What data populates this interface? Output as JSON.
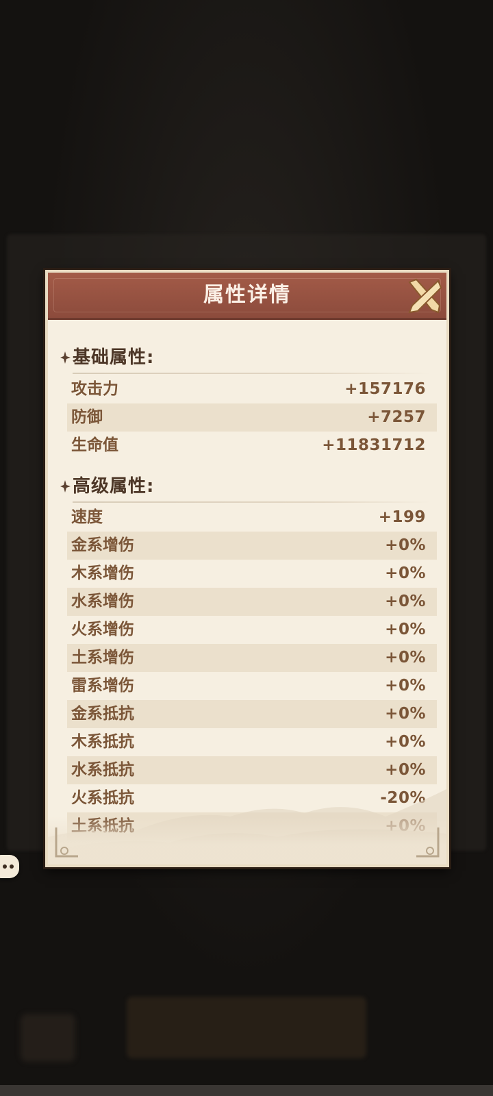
{
  "panel": {
    "title": "属性详情",
    "close_icon": "close-x-icon"
  },
  "sections": {
    "basic": {
      "title": "基础属性:",
      "rows": [
        {
          "label": "攻击力",
          "value": "+157176"
        },
        {
          "label": "防御",
          "value": "+7257"
        },
        {
          "label": "生命值",
          "value": "+11831712"
        }
      ]
    },
    "advanced": {
      "title": "高级属性:",
      "rows": [
        {
          "label": "速度",
          "value": "+199"
        },
        {
          "label": "金系增伤",
          "value": "+0%"
        },
        {
          "label": "木系增伤",
          "value": "+0%"
        },
        {
          "label": "水系增伤",
          "value": "+0%"
        },
        {
          "label": "火系增伤",
          "value": "+0%"
        },
        {
          "label": "土系增伤",
          "value": "+0%"
        },
        {
          "label": "雷系增伤",
          "value": "+0%"
        },
        {
          "label": "金系抵抗",
          "value": "+0%"
        },
        {
          "label": "木系抵抗",
          "value": "+0%"
        },
        {
          "label": "水系抵抗",
          "value": "+0%"
        },
        {
          "label": "火系抵抗",
          "value": "-20%"
        },
        {
          "label": "土系抵抗",
          "value": "+0%"
        }
      ]
    }
  },
  "colors": {
    "header": "#9a5444",
    "paper": "#f6efe1",
    "row_shade": "#ebe0cc",
    "text": "#7b5638",
    "section_title": "#4c3626"
  }
}
